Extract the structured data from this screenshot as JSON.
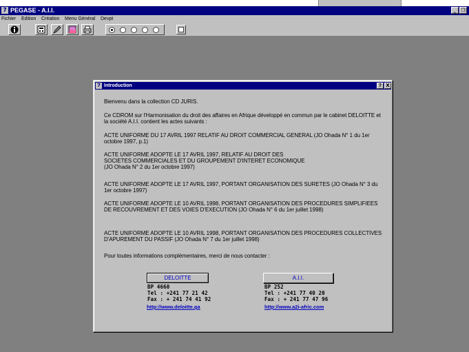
{
  "window": {
    "title": "PEGASE - A.I.I.",
    "minimize_glyph": "_",
    "maximize_glyph": "❐"
  },
  "menubar": [
    "Fichier",
    "Edition",
    "Création",
    "Menu Général",
    "Devpt"
  ],
  "toolbar": {
    "icons": [
      "info-icon",
      "calculator-icon",
      "edit-icon",
      "image-icon",
      "print-icon"
    ],
    "radio_count": 5,
    "radio_selected_index": 0
  },
  "dialog": {
    "title": "Introduction",
    "help_glyph": "?",
    "close_glyph": "X",
    "paragraphs": [
      "Bienvenu dans la collection CD JURIS.",
      "Ce CDROM sur l'Harmonisation du droit des affaires en Afrique développé en commun par le cabinet DELOITTE et la société A.I.I. contient les actes suivants :",
      "ACTE UNIFORME DU 17 AVRIL 1997 RELATIF AU DROIT COMMERCIAL GENERAL (JO Ohada N° 1 du 1er octobre 1997, p.1)",
      "ACTE UNIFORME ADOPTE LE 17 AVRIL 1997, RELATIF AU DROIT DES SOCIETES COMMERCIALES ET DU GROUPEMENT D'INTERET ECONOMIQUE (JO Ohada N° 2 du 1er octobre 1997)",
      "ACTE UNIFORME ADOPTE LE 17 AVRIL 1997, PORTANT ORGANISATION DES SURETES (JO Ohada N° 3 du 1er octobre 1997)",
      "ACTE UNIFORME ADOPTE LE 10 AVRIL 1998, PORTANT ORGANISATION DES PROCEDURES SIMPLIFIEES DE RECOUVREMENT ET DES VOIES D'EXECUTION (JO Ohada N° 6 du 1er juillet 1998)",
      "ACTE UNIFORME ADOPTE LE 10 AVRIL 1998, PORTANT ORGANISATION DES PROCEDURES COLLECTIVES D'APUREMENT DU PASSIF (JO Ohada N° 7 du 1er juillet 1998)",
      "Pour toutes informations complémentaires, merci de nous contacter :"
    ],
    "contacts": [
      {
        "button_label": "DELOITTE",
        "bp": "BP 4660",
        "tel": "Tel : +241 77 21 42",
        "fax": "Fax : + 241 74 41 92",
        "url": "http://www.deloitte.ga"
      },
      {
        "button_label": "A.I.I.",
        "bp": "BP 252",
        "tel": "Tel : +241 77 40 20",
        "fax": "Fax : + 241 77 47 96",
        "url": "http://www.a2i-afric.com"
      }
    ]
  }
}
